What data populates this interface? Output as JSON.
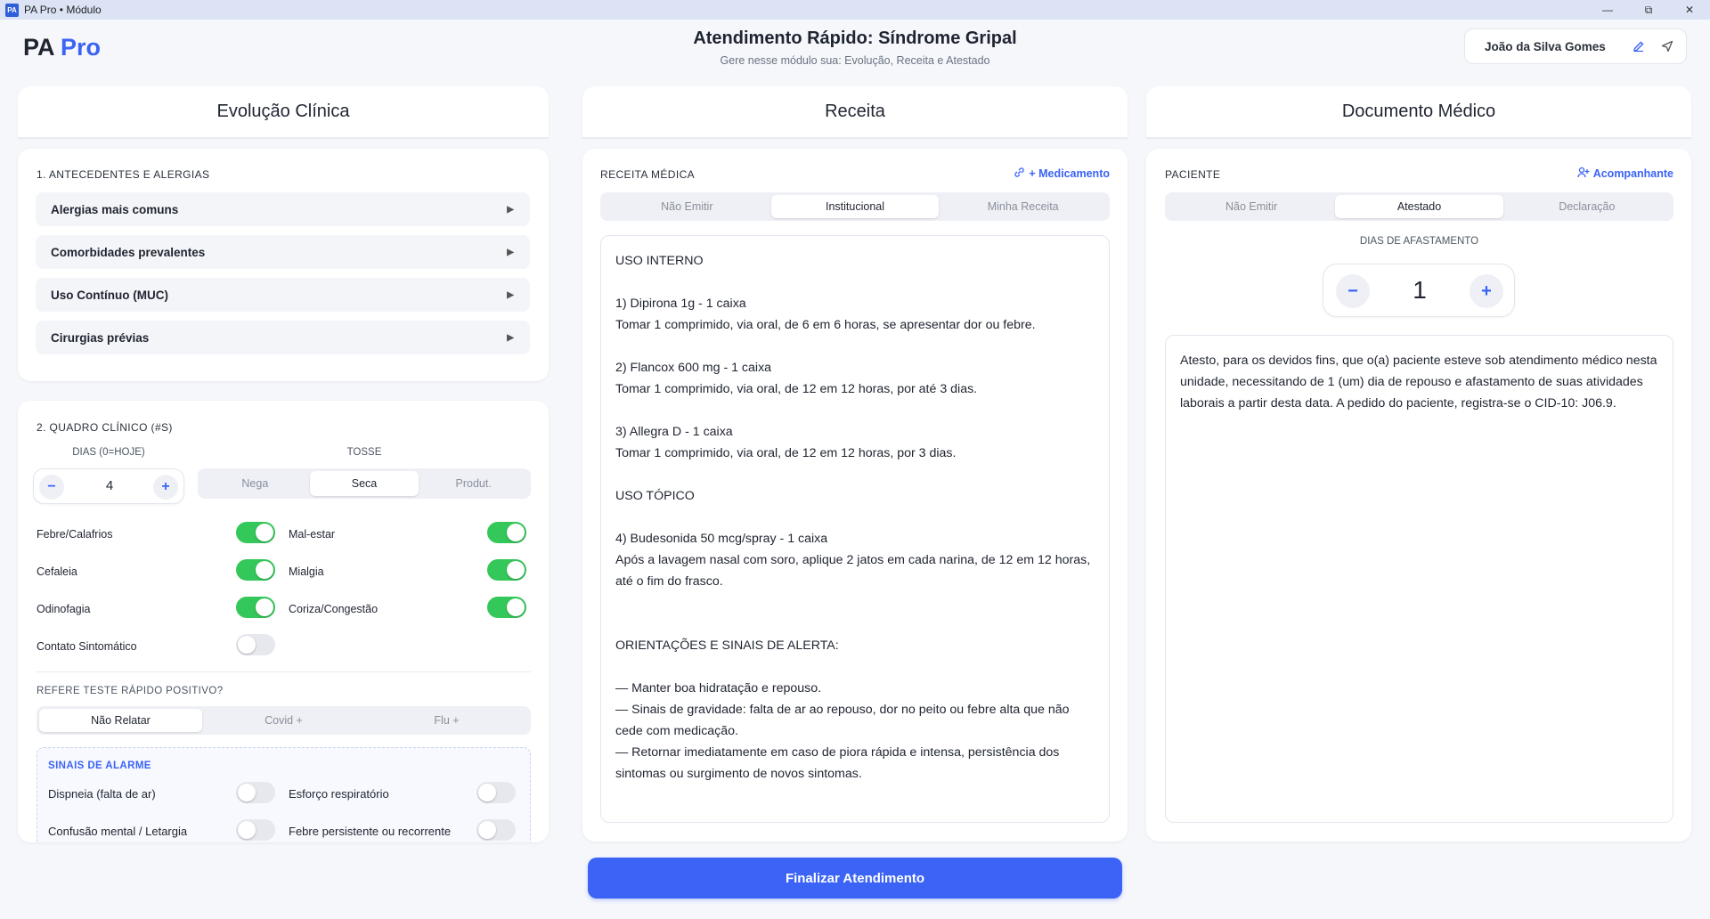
{
  "window": {
    "title": "PA Pro • Módulo",
    "logo": "PA"
  },
  "brand": {
    "name": "PA",
    "suffix": "Pro"
  },
  "header": {
    "title": "Atendimento Rápido: Síndrome Gripal",
    "subtitle": "Gere nesse módulo sua: Evolução, Receita e Atestado"
  },
  "user": {
    "name": "João da Silva Gomes",
    "edit_icon": "pencil-icon",
    "send_icon": "send-icon"
  },
  "panels": {
    "evolucao": "Evolução Clínica",
    "receita": "Receita",
    "documento": "Documento Médico"
  },
  "antecedentes": {
    "title": "1. ANTECEDENTES E ALERGIAS",
    "items": [
      "Alergias mais comuns",
      "Comorbidades prevalentes",
      "Uso Contínuo (MUC)",
      "Cirurgias prévias"
    ]
  },
  "quadro": {
    "title": "2. QUADRO CLÍNICO (#S)",
    "dias_label": "DIAS (0=HOJE)",
    "dias_value": "4",
    "tosse_label": "TOSSE",
    "tosse_options": [
      "Nega",
      "Seca",
      "Produt."
    ],
    "tosse_selected": "Seca",
    "symptoms": [
      {
        "label": "Febre/Calafrios",
        "on": true
      },
      {
        "label": "Mal-estar",
        "on": true
      },
      {
        "label": "Cefaleia",
        "on": true
      },
      {
        "label": "Mialgia",
        "on": true
      },
      {
        "label": "Odinofagia",
        "on": true
      },
      {
        "label": "Coriza/Congestão",
        "on": true
      },
      {
        "label": "Contato Sintomático",
        "on": false
      }
    ],
    "teste_label": "REFERE TESTE RÁPIDO POSITIVO?",
    "teste_options": [
      "Não Relatar",
      "Covid +",
      "Flu +"
    ],
    "teste_selected": "Não Relatar",
    "alarme_title": "SINAIS DE ALARME",
    "alarmes": [
      {
        "label": "Dispneia (falta de ar)",
        "on": false
      },
      {
        "label": "Esforço respiratório",
        "on": false
      },
      {
        "label": "Confusão mental / Letargia",
        "on": false
      },
      {
        "label": "Febre persistente ou recorrente",
        "on": false
      }
    ]
  },
  "receita": {
    "title": "RECEITA MÉDICA",
    "add_label": "+ Medicamento",
    "options": [
      "Não Emitir",
      "Institucional",
      "Minha Receita"
    ],
    "selected": "Institucional",
    "text": "USO INTERNO\n\n1) Dipirona 1g - 1 caixa\nTomar 1 comprimido, via oral, de 6 em 6 horas, se apresentar dor ou febre.\n\n2) Flancox 600 mg - 1 caixa\nTomar 1 comprimido, via oral, de 12 em 12 horas, por até 3 dias.\n\n3) Allegra D - 1 caixa\nTomar 1 comprimido, via oral, de 12 em 12 horas, por 3 dias.\n\nUSO TÓPICO\n\n4) Budesonida 50 mcg/spray - 1 caixa\nApós a lavagem nasal com soro, aplique 2 jatos em cada narina, de 12 em 12 horas, até o fim do frasco.\n\n\nORIENTAÇÕES E SINAIS DE ALERTA:\n\n— Manter boa hidratação e repouso.\n— Sinais de gravidade: falta de ar ao repouso, dor no peito ou febre alta que não cede com medicação.\n— Retornar imediatamente em caso de piora rápida e intensa, persistência dos sintomas ou surgimento de novos sintomas."
  },
  "documento": {
    "title": "PACIENTE",
    "add_label": "Acompanhante",
    "options": [
      "Não Emitir",
      "Atestado",
      "Declaração"
    ],
    "selected": "Atestado",
    "dias_label": "DIAS DE AFASTAMENTO",
    "dias_value": "1",
    "text": "Atesto, para os devidos fins, que o(a) paciente esteve sob atendimento médico nesta unidade, necessitando de 1 (um) dia de repouso e afastamento de suas atividades laborais a partir desta data. A pedido do paciente, registra-se o CID-10: J06.9."
  },
  "footer": {
    "finalize": "Finalizar Atendimento"
  },
  "colors": {
    "accent": "#3b63f5",
    "toggle_on": "#34c759"
  }
}
